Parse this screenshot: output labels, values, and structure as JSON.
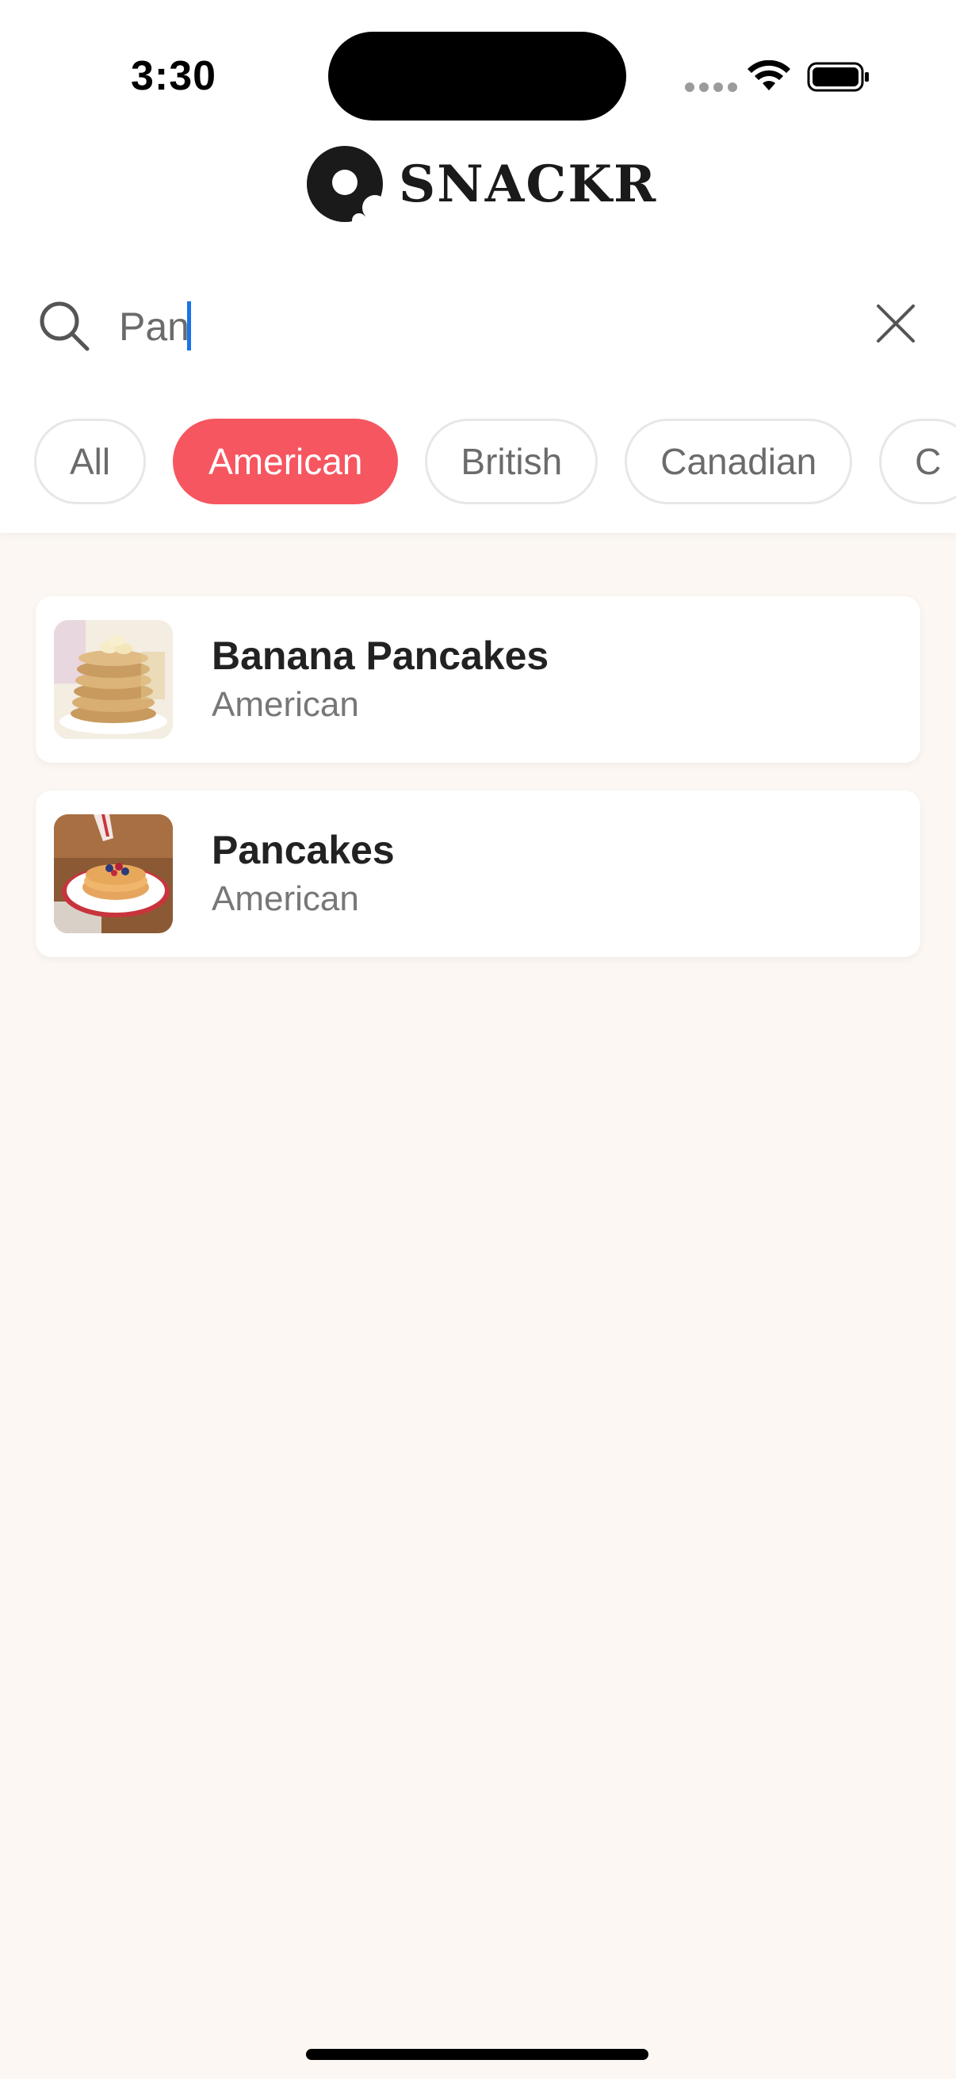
{
  "status_bar": {
    "time": "3:30"
  },
  "brand": {
    "name": "SNACKR"
  },
  "search": {
    "value": "Pan",
    "placeholder": ""
  },
  "filters": [
    {
      "label": "All",
      "active": false
    },
    {
      "label": "American",
      "active": true
    },
    {
      "label": "British",
      "active": false
    },
    {
      "label": "Canadian",
      "active": false
    },
    {
      "label": "C",
      "active": false
    }
  ],
  "results": [
    {
      "title": "Banana Pancakes",
      "cuisine": "American",
      "image": "pancake-stack-photo"
    },
    {
      "title": "Pancakes",
      "cuisine": "American",
      "image": "pancakes-with-berries-photo"
    }
  ],
  "colors": {
    "accent": "#f65660",
    "background": "#fcf7f2",
    "card": "#ffffff"
  }
}
